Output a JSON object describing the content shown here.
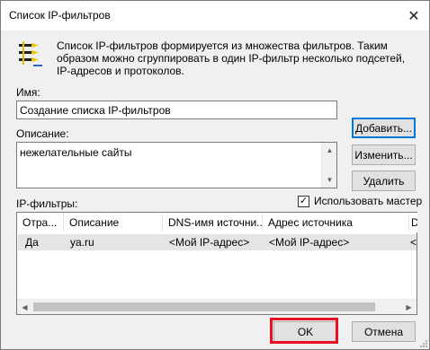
{
  "window": {
    "title": "Список IP-фильтров",
    "close_glyph": "✕"
  },
  "intro": {
    "text": "Список IP-фильтров формируется из множества фильтров. Таким образом можно сгруппировать в один IP-фильтр несколько подсетей, IP-адресов и протоколов."
  },
  "name_field": {
    "label": "Имя:",
    "value": "Создание списка IP-фильтров"
  },
  "description_field": {
    "label": "Описание:",
    "value": "нежелательные сайты"
  },
  "buttons": {
    "add": "Добавить...",
    "edit": "Изменить...",
    "delete": "Удалить",
    "ok": "OK",
    "cancel": "Отмена"
  },
  "filters": {
    "label": "IP-фильтры:",
    "wizard_label": "Использовать мастер",
    "wizard_checked": true,
    "columns": [
      "Отра...",
      "Описание",
      "DNS-имя источни...",
      "Адрес источника",
      "D"
    ],
    "rows": [
      {
        "mirrored": "Да",
        "description": "ya.ru",
        "dns": "<Мой IP-адрес>",
        "address": "<Мой IP-адрес>",
        "d": "<"
      }
    ]
  },
  "colors": {
    "highlight": "#e81123",
    "focus": "#0078d7"
  }
}
